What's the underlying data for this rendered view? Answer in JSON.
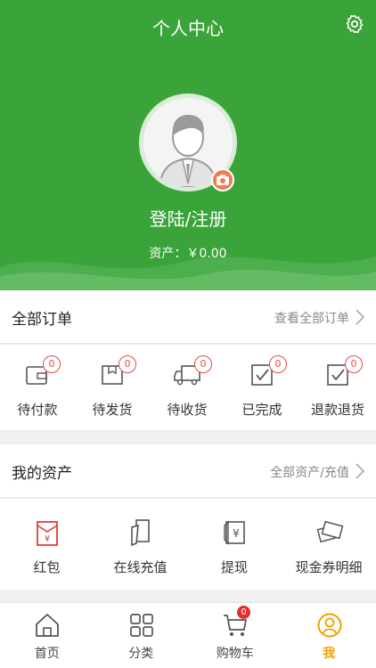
{
  "header": {
    "title": "个人中心",
    "login_label": "登陆/注册",
    "assets_text": "资产：￥0.00"
  },
  "orders": {
    "title": "全部订单",
    "view_all": "查看全部订单",
    "items": [
      {
        "label": "待付款",
        "count": "0",
        "icon": "wallet-icon"
      },
      {
        "label": "待发货",
        "count": "0",
        "icon": "package-icon"
      },
      {
        "label": "待收货",
        "count": "0",
        "icon": "truck-icon"
      },
      {
        "label": "已完成",
        "count": "0",
        "icon": "check-box-icon"
      },
      {
        "label": "退款退货",
        "count": "0",
        "icon": "refund-icon"
      }
    ]
  },
  "assets": {
    "title": "我的资产",
    "view_all": "全部资产/充值",
    "items": [
      {
        "label": "红包",
        "icon": "red-envelope-icon"
      },
      {
        "label": "在线充值",
        "icon": "recharge-icon"
      },
      {
        "label": "提现",
        "icon": "withdraw-icon"
      },
      {
        "label": "现金券明细",
        "icon": "coupon-icon"
      }
    ]
  },
  "tabbar": {
    "items": [
      {
        "label": "首页",
        "icon": "home-icon"
      },
      {
        "label": "分类",
        "icon": "category-icon"
      },
      {
        "label": "购物车",
        "icon": "cart-icon"
      },
      {
        "label": "我",
        "icon": "user-icon"
      }
    ],
    "cart_badge": "0",
    "active_index": 3
  },
  "colors": {
    "brand_green": "#3aa43a",
    "badge_red": "#e24a4a",
    "active_tab": "#f0a000"
  }
}
